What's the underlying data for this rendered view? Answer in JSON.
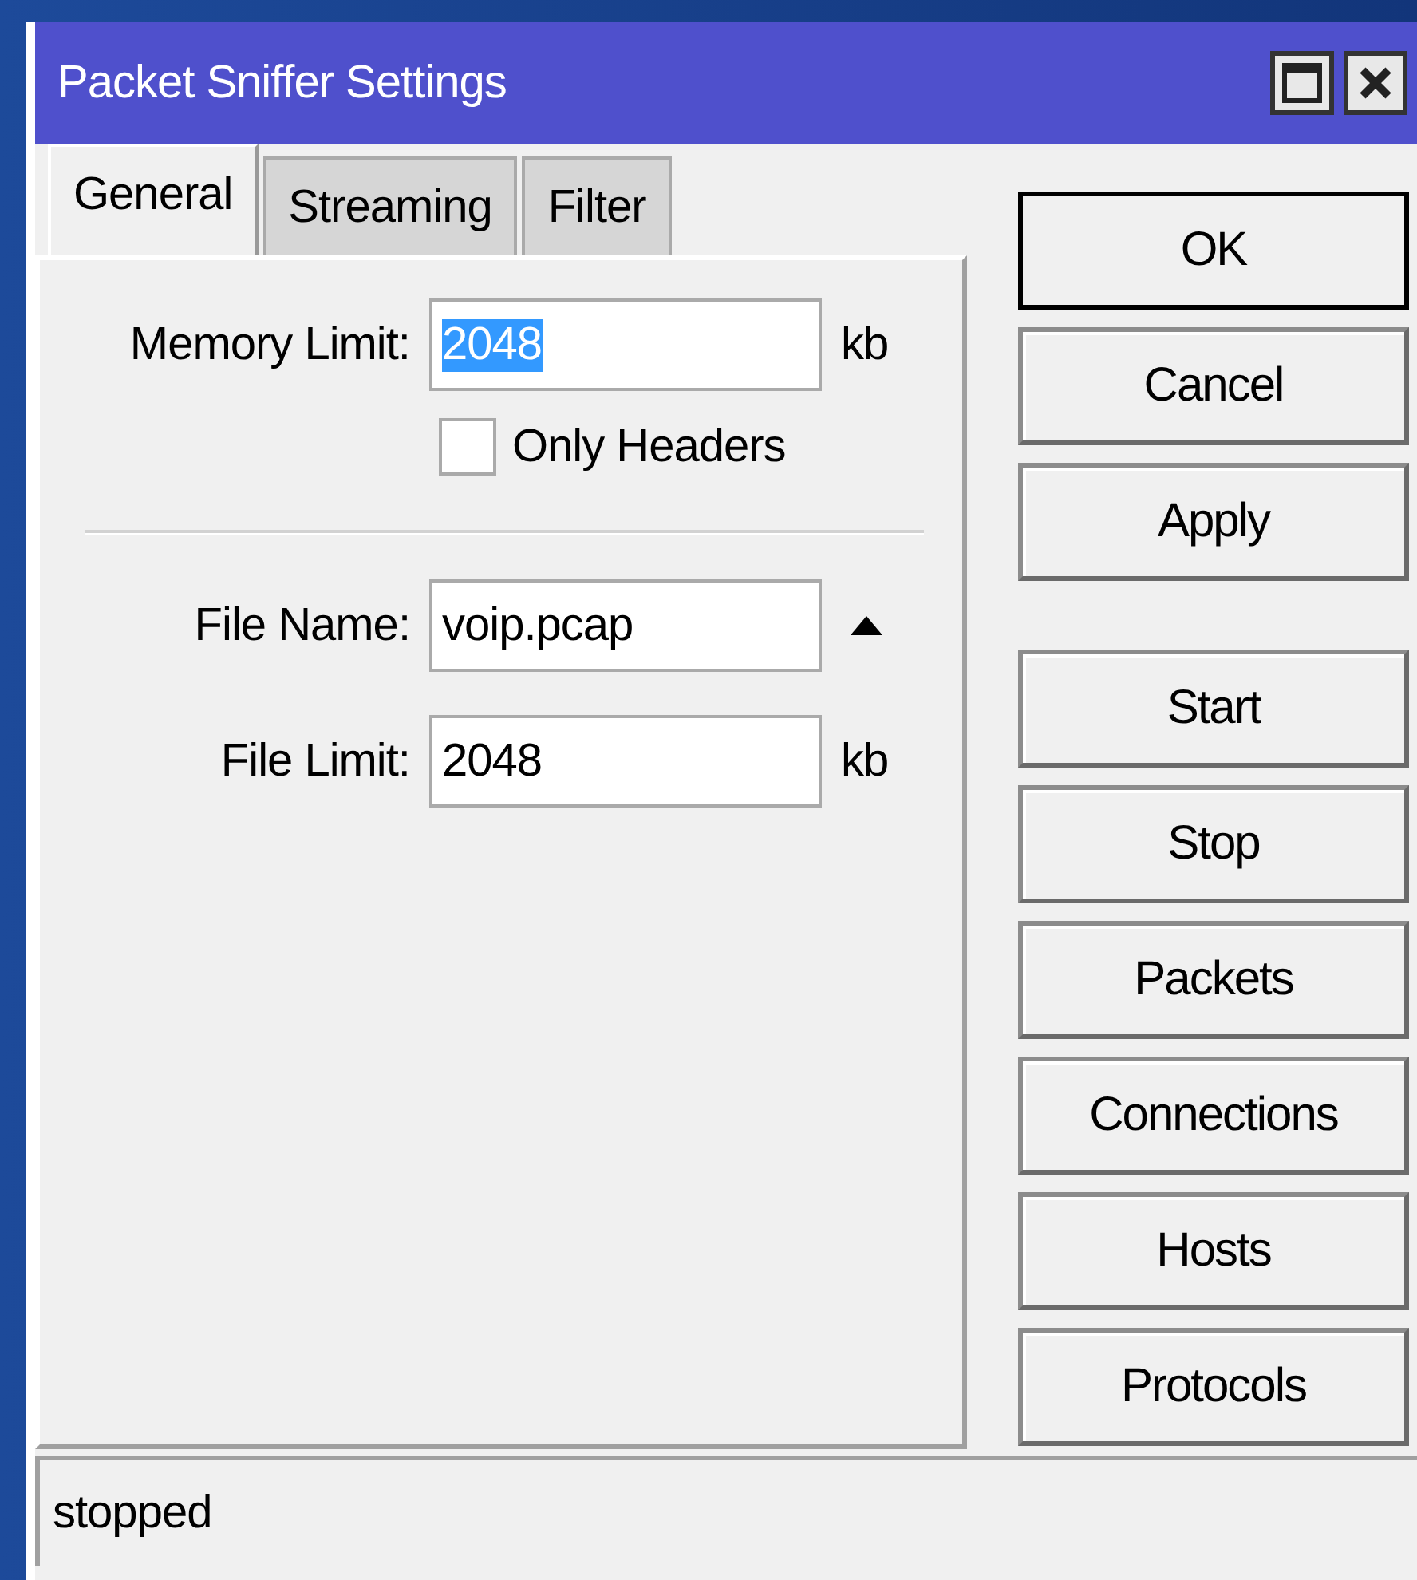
{
  "window": {
    "title": "Packet Sniffer Settings"
  },
  "tabs": [
    {
      "label": "General",
      "selected": true
    },
    {
      "label": "Streaming",
      "selected": false
    },
    {
      "label": "Filter",
      "selected": false
    }
  ],
  "fields": [
    {
      "kind": "input",
      "label": "Memory Limit:",
      "value": "2048",
      "highlighted": true,
      "unit": "kb"
    },
    {
      "kind": "checkbox",
      "label": "Only Headers",
      "checked": false
    },
    {
      "kind": "divider"
    },
    {
      "kind": "input-arrow",
      "label": "File Name:",
      "value": "voip.pcap",
      "highlighted": false
    },
    {
      "kind": "input",
      "label": "File Limit:",
      "value": "2048",
      "highlighted": false,
      "unit": "kb"
    }
  ],
  "dialog_buttons": [
    {
      "label": "OK",
      "default": true
    },
    {
      "label": "Cancel",
      "default": false
    },
    {
      "label": "Apply",
      "default": false
    }
  ],
  "tool_buttons": [
    {
      "label": "Start",
      "default": false
    },
    {
      "label": "Stop",
      "default": false
    },
    {
      "label": "Packets",
      "default": false
    },
    {
      "label": "Connections",
      "default": false
    },
    {
      "label": "Hosts",
      "default": false
    },
    {
      "label": "Protocols",
      "default": false
    }
  ],
  "status_bar": {
    "text": "stopped"
  }
}
